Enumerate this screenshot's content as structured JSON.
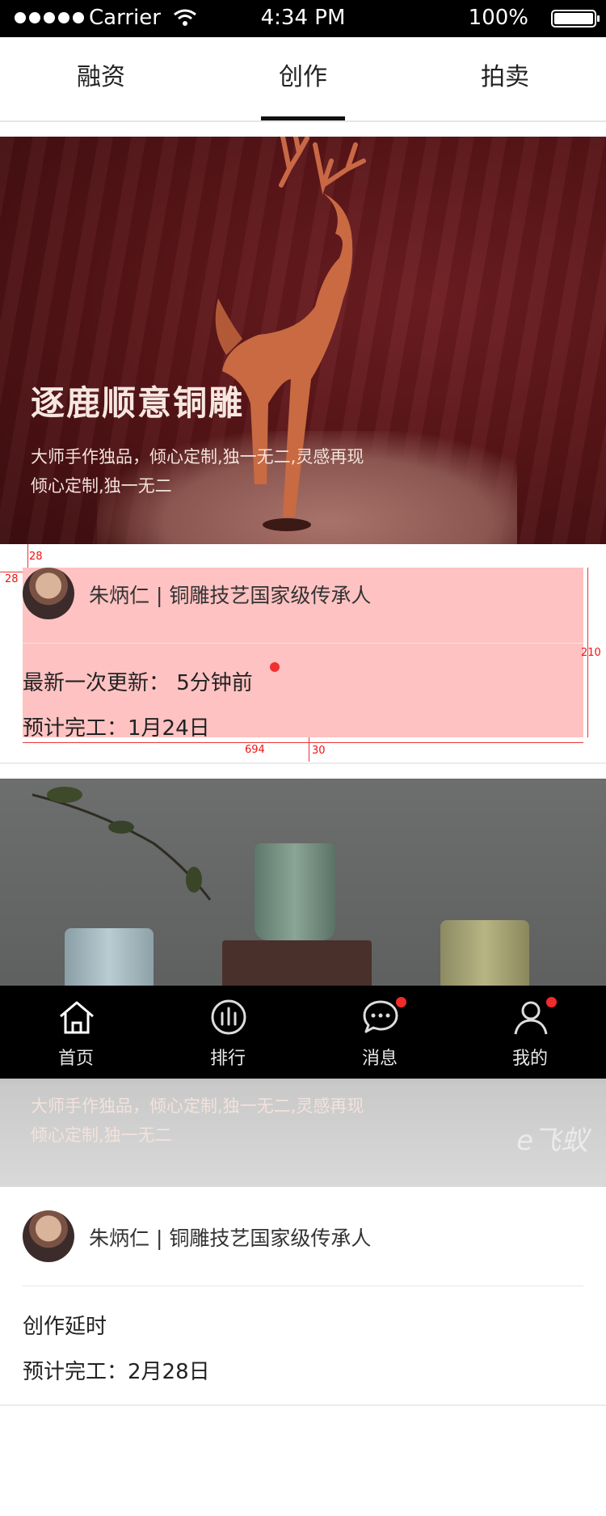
{
  "status_bar": {
    "carrier": "Carrier",
    "time": "4:34 PM",
    "battery": "100%"
  },
  "tabs": [
    {
      "label": "融资",
      "active": false
    },
    {
      "label": "创作",
      "active": true
    },
    {
      "label": "拍卖",
      "active": false
    }
  ],
  "cards": [
    {
      "banner_title": "逐鹿顺意铜雕",
      "banner_subtitle_1": "大师手作独品，倾心定制,独一无二,灵感再现",
      "banner_subtitle_2": "倾心定制,独一无二",
      "author": "朱炳仁 | 铜雕技艺国家级传承人",
      "line1": "最新一次更新： 5分钟前",
      "line2": "预计完工：1月24日"
    },
    {
      "banner_subtitle_1": "大师手作独品，倾心定制,独一无二,灵感再现",
      "banner_subtitle_2": "倾心定制,独一无二",
      "author": "朱炳仁 | 铜雕技艺国家级传承人",
      "line1": "创作延时",
      "line2": "预计完工：2月28日"
    }
  ],
  "annotations": {
    "m28a": "28",
    "m28b": "28",
    "m210": "210",
    "m694": "694",
    "m30": "30"
  },
  "watermark": "e飞蚁",
  "bottom_nav": [
    {
      "label": "首页",
      "icon": "home-icon",
      "badge": false
    },
    {
      "label": "排行",
      "icon": "ranking-icon",
      "badge": false
    },
    {
      "label": "消息",
      "icon": "message-icon",
      "badge": true
    },
    {
      "label": "我的",
      "icon": "profile-icon",
      "badge": true
    }
  ],
  "colors": {
    "accent_red": "#f23030",
    "banner1_bg": "#5a1518",
    "overlay": "#ff7878"
  }
}
